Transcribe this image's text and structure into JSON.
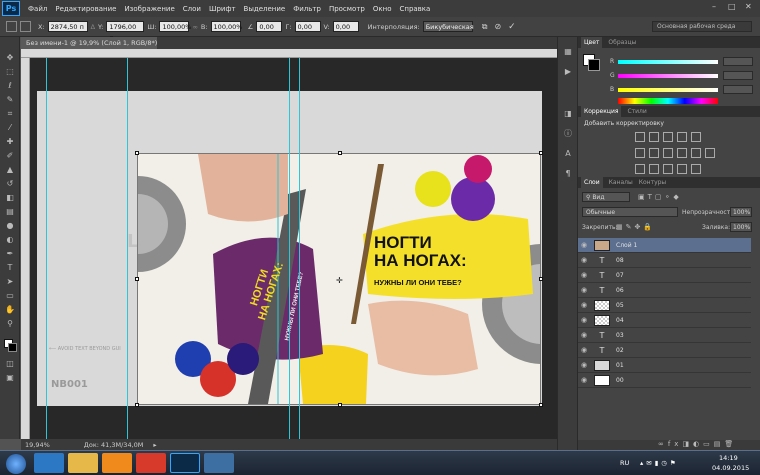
{
  "app": {
    "logo": "Ps"
  },
  "menu": [
    "Файл",
    "Редактирование",
    "Изображение",
    "Слои",
    "Шрифт",
    "Выделение",
    "Фильтр",
    "Просмотр",
    "Окно",
    "Справка"
  ],
  "options": {
    "x_label": "X:",
    "x_value": "2874,50 п",
    "y_label": "Y:",
    "y_value": "1796,00 п",
    "w_label": "Ш:",
    "w_value": "100,00%",
    "h_label": "В:",
    "h_value": "100,00%",
    "angle_value": "0,00",
    "hskew_label": "Г:",
    "hskew_value": "0,00",
    "vskew_label": "V:",
    "vskew_value": "0,00",
    "interp_label": "Интерполяция:",
    "interp_value": "Бикубическая",
    "workspace": "Основная рабочая среда"
  },
  "document": {
    "tab_title": "Без имени-1 @ 19,9% (Слой 1, RGB/8*)",
    "zoom": "19,94%",
    "doc_info": "Док: 41,3M/34,0M"
  },
  "artwork": {
    "title_line1": "НОГТИ",
    "title_line2": "НА НОГАХ:",
    "subtitle": "НУЖНЫ ЛИ ОНИ ТЕБЕ?",
    "rot_line1": "НОГТИ",
    "rot_line2": "НА НОГАХ:",
    "strip_text": "НУЖНЫ ЛИ ОНИ ТЕБЕ?",
    "bg_avoid_text": "AVOID TEXT BEYOND GUI",
    "bg_code": "NB001"
  },
  "color_panel": {
    "tabs": [
      "Цвет",
      "Образцы"
    ],
    "r_label": "R",
    "g_label": "G",
    "b_label": "B"
  },
  "adjust_panel": {
    "tabs": [
      "Коррекция",
      "Стили"
    ],
    "heading": "Добавить корректировку"
  },
  "layers_panel": {
    "tabs": [
      "Слои",
      "Каналы",
      "Контуры"
    ],
    "filter": "Вид",
    "blend_mode": "Обычные",
    "opacity_label": "Непрозрачность:",
    "opacity_value": "100%",
    "lock_label": "Закрепить:",
    "fill_label": "Заливка:",
    "fill_value": "100%",
    "layers": [
      {
        "name": "Слой 1",
        "type": "image",
        "selected": true
      },
      {
        "name": "08",
        "type": "text"
      },
      {
        "name": "07",
        "type": "text"
      },
      {
        "name": "06",
        "type": "text"
      },
      {
        "name": "05",
        "type": "raster"
      },
      {
        "name": "04",
        "type": "raster"
      },
      {
        "name": "03",
        "type": "text"
      },
      {
        "name": "02",
        "type": "text"
      },
      {
        "name": "01",
        "type": "raster"
      },
      {
        "name": "00",
        "type": "white"
      }
    ]
  },
  "taskbar": {
    "lang": "RU",
    "time": "14:19",
    "date": "04.09.2015"
  }
}
